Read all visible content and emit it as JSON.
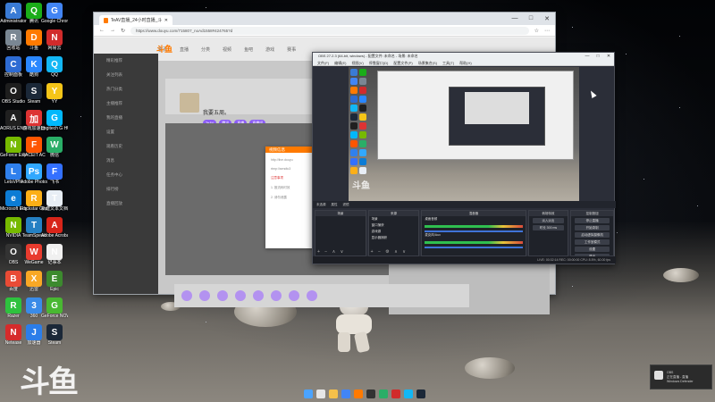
{
  "desktop": {
    "icons": [
      {
        "label": "Administrator",
        "color": "#3a7bd5",
        "glyph": "A"
      },
      {
        "label": "腾讯",
        "color": "#1aad19",
        "glyph": "Q"
      },
      {
        "label": "Google Chrome",
        "color": "#4285f4",
        "glyph": "G"
      },
      {
        "label": "回收站",
        "color": "#7a8793",
        "glyph": "R"
      },
      {
        "label": "斗鱼",
        "color": "#ff7a00",
        "glyph": "D"
      },
      {
        "label": "网易云",
        "color": "#d12b2b",
        "glyph": "N"
      },
      {
        "label": "控制面板",
        "color": "#2d6bd3",
        "glyph": "C"
      },
      {
        "label": "酷狗",
        "color": "#2a87ff",
        "glyph": "K"
      },
      {
        "label": "QQ",
        "color": "#12b7f5",
        "glyph": "Q"
      },
      {
        "label": "OBS Studio",
        "color": "#1e1e1e",
        "glyph": "O"
      },
      {
        "label": "Steam",
        "color": "#1b2838",
        "glyph": "S"
      },
      {
        "label": "YY",
        "color": "#f5c518",
        "glyph": "Y"
      },
      {
        "label": "AORUS ENGINE",
        "color": "#202020",
        "glyph": "A"
      },
      {
        "label": "游戏加速器",
        "color": "#d33",
        "glyph": "加"
      },
      {
        "label": "Logitech G HUB",
        "color": "#00b8fc",
        "glyph": "G"
      },
      {
        "label": "GeForce Experience",
        "color": "#76b900",
        "glyph": "N"
      },
      {
        "label": "FACEIT AC",
        "color": "#ff5500",
        "glyph": "F"
      },
      {
        "label": "微信",
        "color": "#2aae67",
        "glyph": "W"
      },
      {
        "label": "LetsVPN",
        "color": "#2f80ed",
        "glyph": "L"
      },
      {
        "label": "Adobe Photoshop",
        "color": "#31a8ff",
        "glyph": "Ps"
      },
      {
        "label": "飞书",
        "color": "#3370ff",
        "glyph": "F"
      },
      {
        "label": "Microsoft Edge",
        "color": "#0c7cd5",
        "glyph": "e"
      },
      {
        "label": "Rockstar Games",
        "color": "#fcaf17",
        "glyph": "R"
      },
      {
        "label": "新建文本文档",
        "color": "#e8eef5",
        "glyph": "T"
      },
      {
        "label": "NVIDIA",
        "color": "#76b900",
        "glyph": "N"
      },
      {
        "label": "TeamSpeak",
        "color": "#2580c3",
        "glyph": "T"
      },
      {
        "label": "Adobe Acrobat",
        "color": "#d8251a",
        "glyph": "A"
      },
      {
        "label": "OBS",
        "color": "#333",
        "glyph": "O"
      },
      {
        "label": "WeGame",
        "color": "#e83b2e",
        "glyph": "W"
      },
      {
        "label": "记事本",
        "color": "#f0f0f0",
        "glyph": "N"
      },
      {
        "label": "百度",
        "color": "#e94b35",
        "glyph": "B"
      },
      {
        "label": "迅雷",
        "color": "#f9a825",
        "glyph": "X"
      },
      {
        "label": "Epic",
        "color": "#3c8a2e",
        "glyph": "E"
      },
      {
        "label": "Razer",
        "color": "#2ec23e",
        "glyph": "R"
      },
      {
        "label": "360",
        "color": "#3a8be8",
        "glyph": "3"
      },
      {
        "label": "GeForce NOW",
        "color": "#49b832",
        "glyph": "G"
      },
      {
        "label": "Netease",
        "color": "#d62b2b",
        "glyph": "N"
      },
      {
        "label": "加速器",
        "color": "#2b7de9",
        "glyph": "J"
      },
      {
        "label": "Steam",
        "color": "#1b2838",
        "glyph": "S"
      }
    ]
  },
  "browser": {
    "tab_title": "TeAV直播_24小时直播_斗鱼直播",
    "url": "https://www.douyu.com/715807_noAd1558#424765?d",
    "brand": "斗鱼",
    "nav": [
      "首页",
      "直播",
      "分类",
      "视频",
      "鱼吧",
      "游戏",
      "赛事"
    ],
    "room_title": "我要五周。",
    "room_tags": [
      "TeAV",
      "腾讯",
      "直播",
      "直播间"
    ],
    "sidebar_rows": [
      "精彩推荐",
      "关注列表",
      "热门分类",
      "主播推荐",
      "我的直播",
      "设置",
      "观看历史",
      "消息",
      "任务中心",
      "排行榜",
      "直播回放"
    ],
    "dialog_title": "视频信息",
    "dialog_lines": [
      "http://live.douyu",
      "rtmp://sendtc3",
      "注意事项",
      "1. 推流码时效",
      "2. 请勿泄露"
    ],
    "window_controls": [
      "—",
      "□",
      "✕"
    ]
  },
  "obs": {
    "title": "OBS 27.2.3 (64-bit, windows) - 配置文件: 未命名 - 场景: 未命名",
    "menus": [
      "文件(F)",
      "编辑(E)",
      "视图(V)",
      "停靠窗口(D)",
      "配置文件(P)",
      "场景集合(S)",
      "工具(T)",
      "帮助(H)"
    ],
    "preview_watermark": "斗鱼",
    "scene_bar": [
      "未选源",
      "属性",
      "滤镜"
    ],
    "docks": {
      "scenes": {
        "title": "场景",
        "items": []
      },
      "sources": {
        "title": "来源",
        "items": [
          "场景",
          "窗口捕获",
          "游戏源",
          "显示器捕获"
        ]
      },
      "mixer": {
        "title": "混音器",
        "items": [
          "桌面音频",
          "麦克风/Aux"
        ]
      },
      "transitions": {
        "title": "转场特效",
        "items": [
          "淡入淡出",
          "时长 300 ms"
        ]
      },
      "controls": {
        "title": "控制按钮",
        "items": [
          "停止直播",
          "开始录制",
          "启动虚拟摄像机",
          "工作室模式",
          "设置",
          "退出"
        ]
      }
    },
    "status": "LIVE: 00:32:14  REC: 00:00:00  CPU: 8.5%, 60.00 fps"
  },
  "toast": {
    "line1": "OBS",
    "line2": "正在直播 - 直播",
    "line3": "Windows Defender"
  },
  "big_watermark": "斗鱼",
  "taskbar": {
    "icons": [
      {
        "name": "windows-start-icon",
        "color": "#4aa3ff"
      },
      {
        "name": "search-icon",
        "color": "#e6e6e6"
      },
      {
        "name": "file-explorer-icon",
        "color": "#f5c04a"
      },
      {
        "name": "chrome-icon",
        "color": "#4285f4"
      },
      {
        "name": "douyu-icon",
        "color": "#ff7a00"
      },
      {
        "name": "obs-icon",
        "color": "#333333"
      },
      {
        "name": "wechat-icon",
        "color": "#2aae67"
      },
      {
        "name": "netease-icon",
        "color": "#d12b2b"
      },
      {
        "name": "qq-icon",
        "color": "#12b7f5"
      },
      {
        "name": "steam-icon",
        "color": "#1b2838"
      }
    ]
  }
}
